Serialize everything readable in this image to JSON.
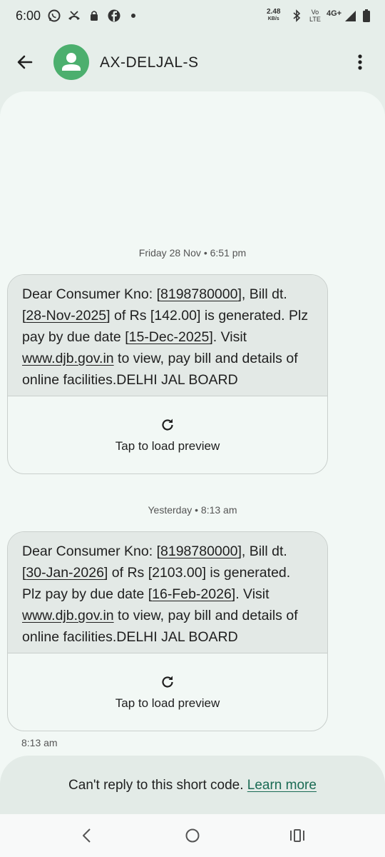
{
  "status_bar": {
    "time": "6:00",
    "speed_value": "2.48",
    "speed_unit": "KB/s",
    "volte_top": "Vo",
    "volte_bottom": "LTE",
    "network": "4G+"
  },
  "header": {
    "contact_name": "AX-DELJAL-S"
  },
  "messages": [
    {
      "date_label": "Friday 28 Nov",
      "time_label": "6:51 pm",
      "text": {
        "p1": "Dear Consumer Kno: [",
        "consumer_no": "8198780000",
        "p2": "], Bill dt. [",
        "bill_date": "28-Nov-2025",
        "p3": "] of Rs [142.00] is generated. Plz pay by due date [",
        "due_date": "15-Dec-2025",
        "p4": "]. Visit ",
        "link": "www.djb.gov.in",
        "p5": " to view, pay bill and details of online facilities.DELHI JAL BOARD"
      },
      "preview_label": "Tap to load preview"
    },
    {
      "date_label": "Yesterday",
      "time_label": "8:13 am",
      "text": {
        "p1": "Dear Consumer Kno: [",
        "consumer_no": "8198780000",
        "p2": "], Bill dt. [",
        "bill_date": "30-Jan-2026",
        "p3": "] of Rs [2103.00] is generated. Plz pay by due date [",
        "due_date": "16-Feb-2026",
        "p4": "]. Visit ",
        "link": "www.djb.gov.in",
        "p5": " to view, pay bill and details of online facilities.DELHI JAL BOARD"
      },
      "preview_label": "Tap to load preview",
      "sent_time": "8:13 am"
    }
  ],
  "footer": {
    "notice": "Can't reply to this short code. ",
    "learn_more": "Learn more"
  },
  "icons": {
    "status": [
      "whatsapp-icon",
      "missed-call-icon",
      "lock-icon",
      "facebook-icon",
      "bluetooth-icon",
      "signal-icon",
      "battery-icon"
    ],
    "header": [
      "back-arrow-icon",
      "person-icon",
      "more-vert-icon"
    ],
    "preview": "refresh-icon",
    "nav": [
      "nav-back-icon",
      "nav-home-icon",
      "nav-recents-icon"
    ]
  },
  "colors": {
    "background": "#e6eeea",
    "conversation": "#f2f8f5",
    "bubble": "#e3e9e6",
    "avatar": "#4caf6e",
    "link": "#1a6b54"
  }
}
